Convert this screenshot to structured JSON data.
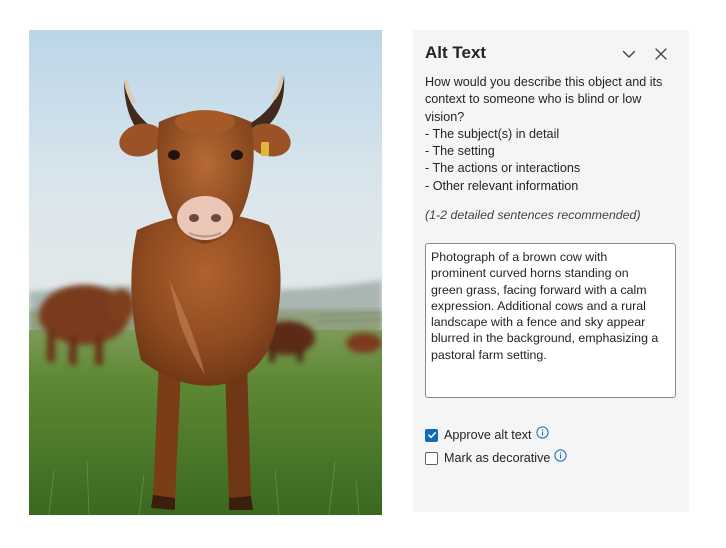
{
  "image": {
    "subject": "brown-cow-photo"
  },
  "pane": {
    "title": "Alt Text",
    "collapse_icon": "chevron-down-icon",
    "close_icon": "close-icon",
    "prompt_lines": [
      "How would you describe this object and its",
      "context to someone who is blind or low",
      "vision?",
      "- The subject(s) in detail",
      "- The setting",
      "- The actions or interactions",
      "- Other relevant information"
    ],
    "hint": "(1-2 detailed sentences recommended)",
    "alt_text_value": "Photograph of a brown cow with\nprominent curved horns standing on\ngreen grass, facing forward with a calm\nexpression. Additional cows and a rural\nlandscape with a fence and sky appear\nblurred in the background, emphasizing a\npastoral farm setting.",
    "approve": {
      "label": "Approve alt text",
      "checked": true
    },
    "decorative": {
      "label": "Mark as decorative",
      "checked": false
    },
    "colors": {
      "accent": "#0f6cbd",
      "pane_bg": "#f5f5f5"
    }
  }
}
